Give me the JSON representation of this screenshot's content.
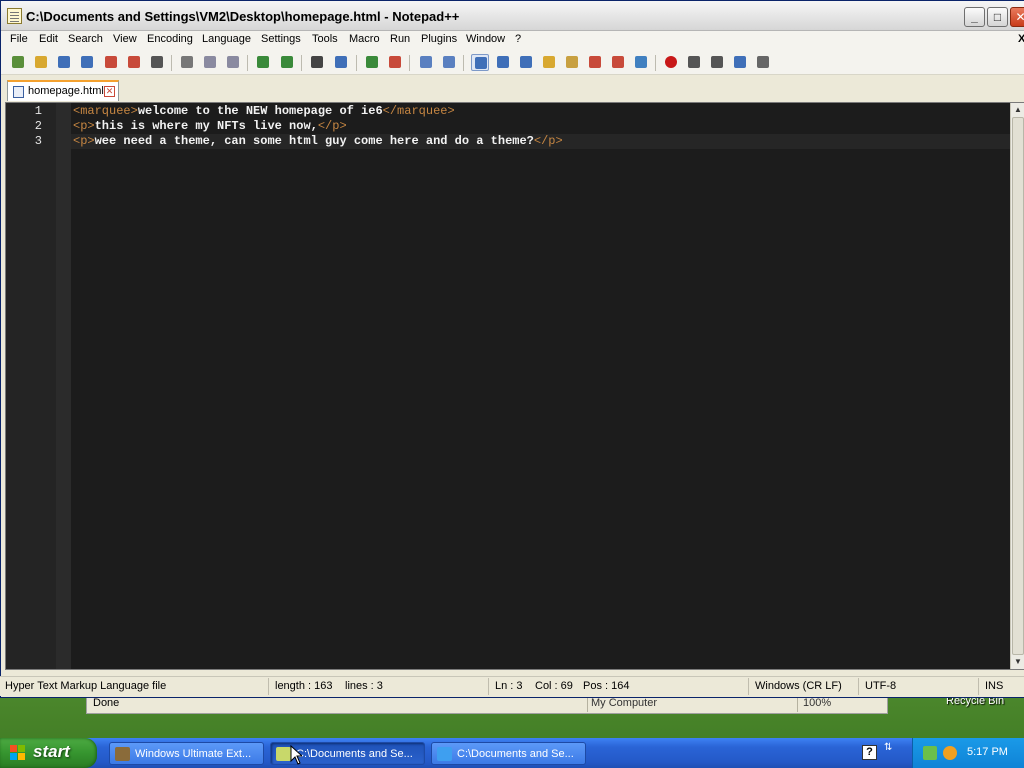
{
  "window": {
    "title": "C:\\Documents and Settings\\VM2\\Desktop\\homepage.html - Notepad++",
    "buttons": {
      "minimize": "_",
      "maximize": "□",
      "close": "✕"
    }
  },
  "menu": {
    "items": [
      "File",
      "Edit",
      "Search",
      "View",
      "Encoding",
      "Language",
      "Settings",
      "Tools",
      "Macro",
      "Run",
      "Plugins",
      "Window",
      "?"
    ],
    "doc_close": "X"
  },
  "toolbar": {
    "icons": [
      "new-icon",
      "open-icon",
      "save-icon",
      "save-all-icon",
      "close-icon",
      "close-all-icon",
      "print-icon",
      "cut-icon",
      "copy-icon",
      "paste-icon",
      "undo-icon",
      "redo-icon",
      "find-icon",
      "replace-icon",
      "zoom-in-icon",
      "zoom-out-icon",
      "sync-v-icon",
      "sync-h-icon",
      "word-wrap-icon",
      "show-all-chars-icon",
      "indent-guide-icon",
      "user-lang-icon",
      "doc-map-icon",
      "function-list-icon",
      "folder-workspace-icon",
      "monitoring-icon",
      "record-macro-icon",
      "stop-macro-icon",
      "play-macro-icon",
      "run-macro-multiple-icon",
      "save-macro-icon"
    ]
  },
  "tabs": [
    {
      "label": "homepage.html",
      "close": "✕"
    }
  ],
  "editor": {
    "lines": [
      {
        "number": "1",
        "tokens": [
          {
            "t": "<marquee>",
            "k": "tag"
          },
          {
            "t": "welcome to the NEW homepage of ie6",
            "k": "txt"
          },
          {
            "t": "</marquee>",
            "k": "tag"
          }
        ]
      },
      {
        "number": "2",
        "tokens": [
          {
            "t": "<p>",
            "k": "tag"
          },
          {
            "t": "this is where my NFTs live now,",
            "k": "txt"
          },
          {
            "t": "</p>",
            "k": "tag"
          }
        ]
      },
      {
        "number": "3",
        "tokens": [
          {
            "t": "<p>",
            "k": "tag"
          },
          {
            "t": "wee need a theme, can some html guy come here and do a theme?",
            "k": "txt"
          },
          {
            "t": "</p>",
            "k": "tag"
          }
        ]
      }
    ],
    "current_line": 3,
    "colors": {
      "background": "#1c1c1c",
      "tag": "#c68642",
      "text": "#f2f2f2"
    }
  },
  "status": {
    "file_type": "Hyper Text Markup Language file",
    "length": "length : 163",
    "lines": "lines : 3",
    "ln": "Ln : 3",
    "col": "Col : 69",
    "pos": "Pos : 164",
    "eol": "Windows (CR LF)",
    "encoding": "UTF-8",
    "mode": "INS"
  },
  "background_ie": {
    "status": "Done",
    "zone": "My Computer",
    "zoom": "100%",
    "desktop_icon_label": "Recycle Bin"
  },
  "taskbar": {
    "start_label": "start",
    "tasks": [
      {
        "label": "Windows Ultimate Ext...",
        "active": false,
        "icon": "gear-app-icon"
      },
      {
        "label": "C:\\Documents and Se...",
        "active": true,
        "icon": "notepadpp-icon"
      },
      {
        "label": "C:\\Documents and Se...",
        "active": false,
        "icon": "ie-icon"
      }
    ],
    "clock": "5:17 PM",
    "help_icon": "?"
  }
}
